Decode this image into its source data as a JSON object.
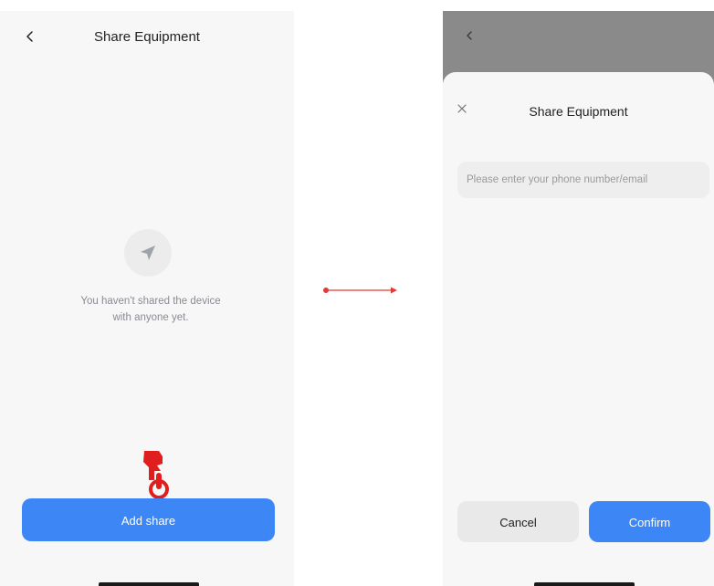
{
  "left_screen": {
    "header": {
      "back_icon": "chevron-left-icon",
      "title": "Share Equipment"
    },
    "empty_state": {
      "icon": "send-icon",
      "line1": "You haven't shared the device",
      "line2": "with anyone yet."
    },
    "tap_hint_icon": "tap-hand-icon",
    "add_share_label": "Add share"
  },
  "right_screen": {
    "overlay_back_icon": "chevron-left-icon",
    "sheet": {
      "close_icon": "close-icon",
      "title": "Share Equipment",
      "input": {
        "placeholder": "Please enter your phone number/email",
        "value": ""
      },
      "cancel_label": "Cancel",
      "confirm_label": "Confirm"
    }
  },
  "colors": {
    "primary": "#3c86f5",
    "annotation_red": "#e53935",
    "background": "#f7f7f7",
    "overlay": "#8a8a8a"
  }
}
